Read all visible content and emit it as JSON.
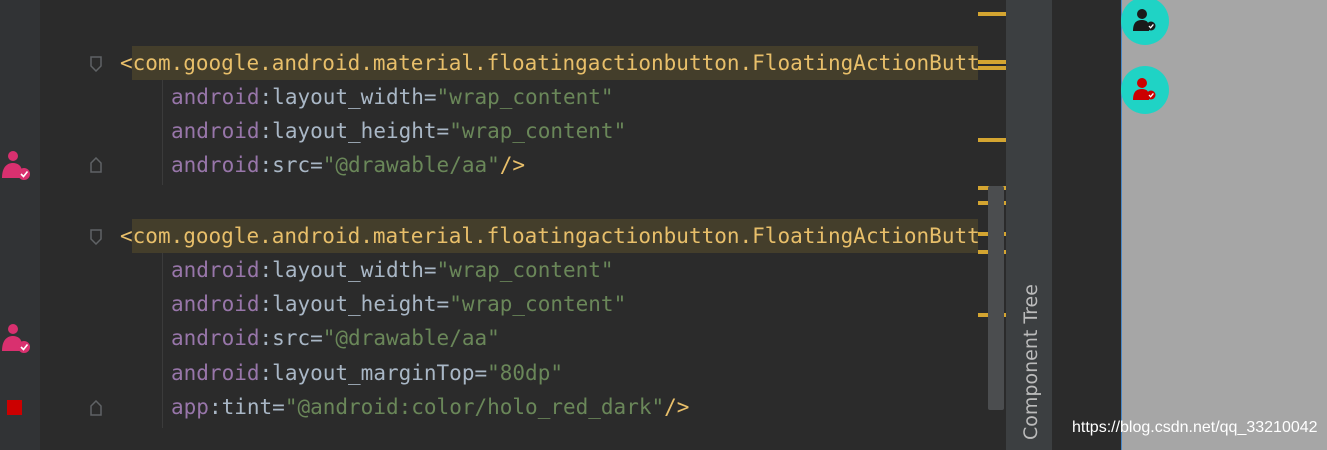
{
  "editor": {
    "block1": {
      "tag_open": "<",
      "tag_name": "com.google.android.material.floatingactionbutton.FloatingActionButto",
      "attrs": [
        {
          "ns": "android",
          "sep": ":",
          "name": "layout_width",
          "eq": "=",
          "value": "\"wrap_content\"",
          "close": ""
        },
        {
          "ns": "android",
          "sep": ":",
          "name": "layout_height",
          "eq": "=",
          "value": "\"wrap_content\"",
          "close": ""
        },
        {
          "ns": "android",
          "sep": ":",
          "name": "src",
          "eq": "=",
          "value": "\"@drawable/aa\"",
          "close": "/>"
        }
      ]
    },
    "block2": {
      "tag_open": "<",
      "tag_name": "com.google.android.material.floatingactionbutton.FloatingActionButto",
      "attrs": [
        {
          "ns": "android",
          "sep": ":",
          "name": "layout_width",
          "eq": "=",
          "value": "\"wrap_content\"",
          "close": ""
        },
        {
          "ns": "android",
          "sep": ":",
          "name": "layout_height",
          "eq": "=",
          "value": "\"wrap_content\"",
          "close": ""
        },
        {
          "ns": "android",
          "sep": ":",
          "name": "src",
          "eq": "=",
          "value": "\"@drawable/aa\"",
          "close": ""
        },
        {
          "ns": "android",
          "sep": ":",
          "name": "layout_marginTop",
          "eq": "=",
          "value": "\"80dp\"",
          "close": ""
        },
        {
          "ns": "app",
          "sep": ":",
          "name": "tint",
          "eq": "=",
          "value": "\"@android:color/holo_red_dark\"",
          "close": "/>"
        }
      ]
    }
  },
  "side_panel": {
    "label": "Component Tree"
  },
  "watermark": "https://blog.csdn.net/qq_33210042",
  "colors": {
    "tag": "#e8bf6a",
    "namespace": "#9876aa",
    "string": "#6a8759",
    "fab": "#1fd3c5",
    "preview_bg": "#a6a6a6"
  }
}
